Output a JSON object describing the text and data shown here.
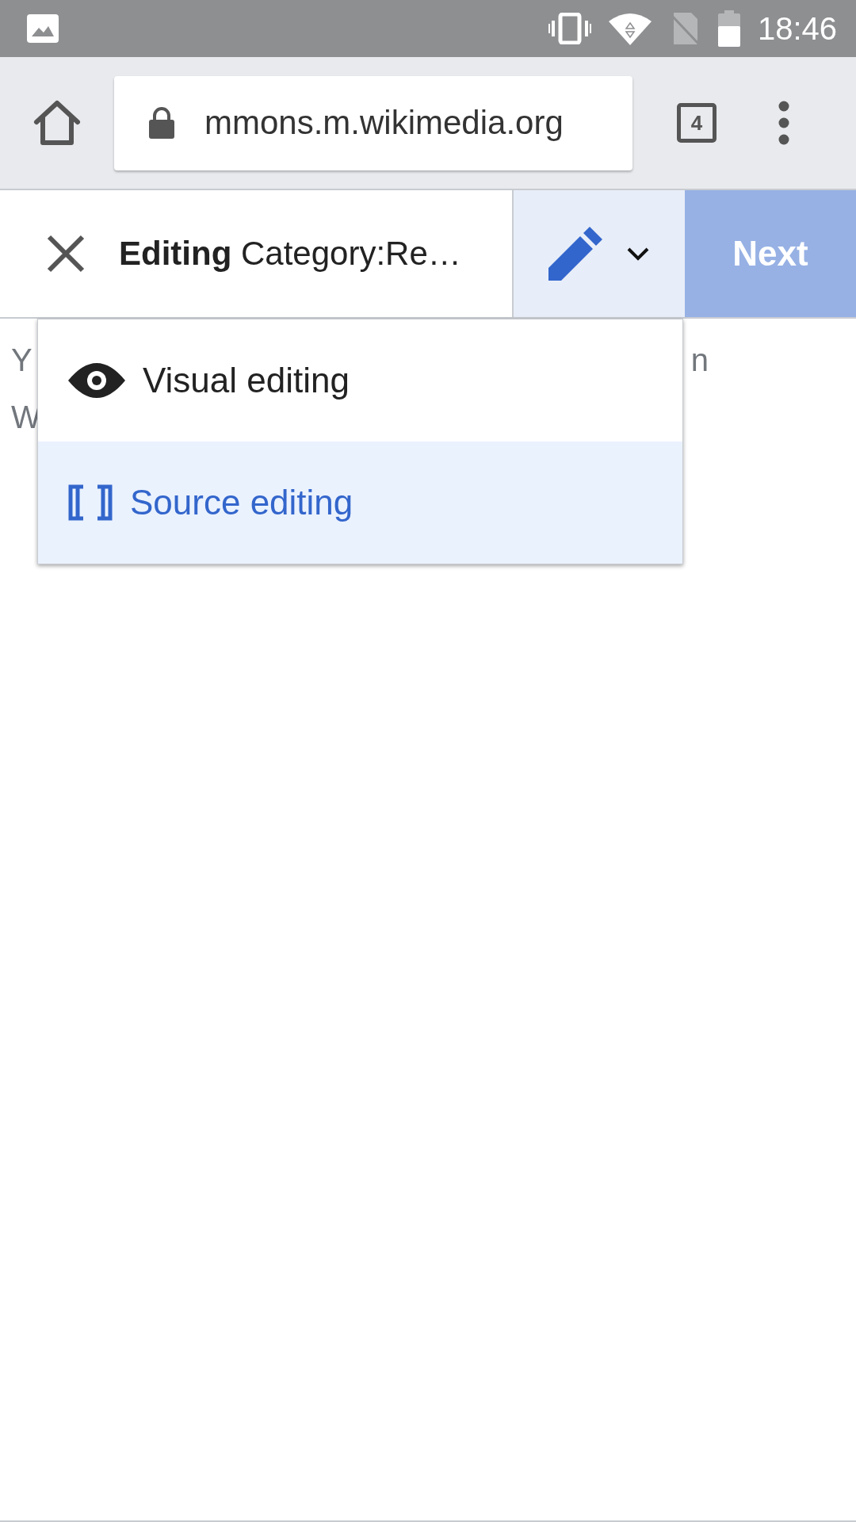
{
  "status_bar": {
    "time": "18:46"
  },
  "browser": {
    "url": "mmons.m.wikimedia.org",
    "tab_count": "4"
  },
  "editor_toolbar": {
    "title": "**Editing** Category:Re…",
    "next_button": {
      "label": "Next",
      "disabled": true
    }
  },
  "background_text": {
    "lines": [
      [
        "Y",
        "n"
      ],
      [
        "W"
      ]
    ]
  },
  "mode_menu": {
    "items": [
      {
        "kind": "visual",
        "label": "Visual editing",
        "selected": false
      },
      {
        "kind": "source",
        "label": "Source editing",
        "selected": true
      }
    ]
  }
}
